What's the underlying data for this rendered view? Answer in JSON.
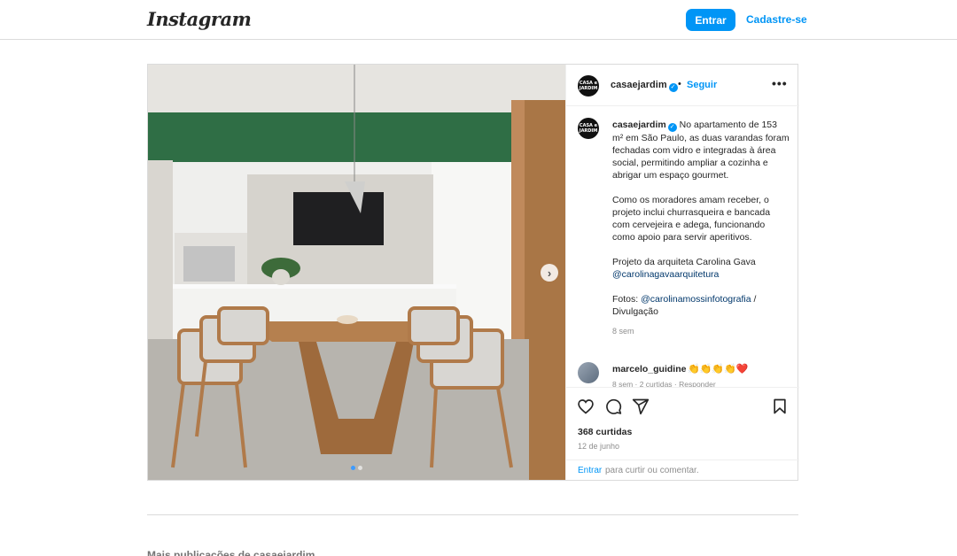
{
  "header": {
    "logo": "Instagram",
    "login_label": "Entrar",
    "signup_label": "Cadastre-se"
  },
  "post": {
    "author": {
      "username": "casaejardim",
      "avatar_text": "CASA e JARDIM",
      "follow_label": "Seguir",
      "separator": "•",
      "more_label": "•••"
    },
    "caption": {
      "username": "casaejardim",
      "paragraph1": "No apartamento de 153 m² em São Paulo, as duas varandas foram fechadas com vidro e integradas à área social, permitindo ampliar a cozinha e abrigar um espaço gourmet.",
      "paragraph2": "Como os moradores amam receber, o projeto inclui churrasqueira e bancada com cervejeira e adega, funcionando como apoio para servir aperitivos.",
      "paragraph3_text": "Projeto da arquiteta Carolina Gava",
      "paragraph3_mention": "@carolinagavaarquitetura",
      "paragraph4_text": "Fotos: ",
      "paragraph4_mention": "@carolinamossinfotografia",
      "paragraph4_suffix": " / Divulgação",
      "time": "8 sem"
    },
    "comment": {
      "username": "marcelo_guidine",
      "text": "👏👏👏👏❤️",
      "meta": "8 sem · 2 curtidas · Responder"
    },
    "likes": "368 curtidas",
    "date": "12 de junho",
    "login_prompt_link": "Entrar",
    "login_prompt_rest": "para curtir ou comentar.",
    "carousel": {
      "current": 1,
      "total": 2,
      "next_icon": "›"
    },
    "icons": [
      "heart-icon",
      "comment-icon",
      "share-icon",
      "bookmark-icon",
      "chevron-right-icon",
      "verified-badge-icon"
    ]
  },
  "footer": {
    "more_posts_label": "Mais publicações de casaejardim"
  },
  "colors": {
    "accent": "#0095f6",
    "border": "#dbdbdb",
    "muted": "#8e8e8e",
    "wall_green": "#2f6e45"
  }
}
